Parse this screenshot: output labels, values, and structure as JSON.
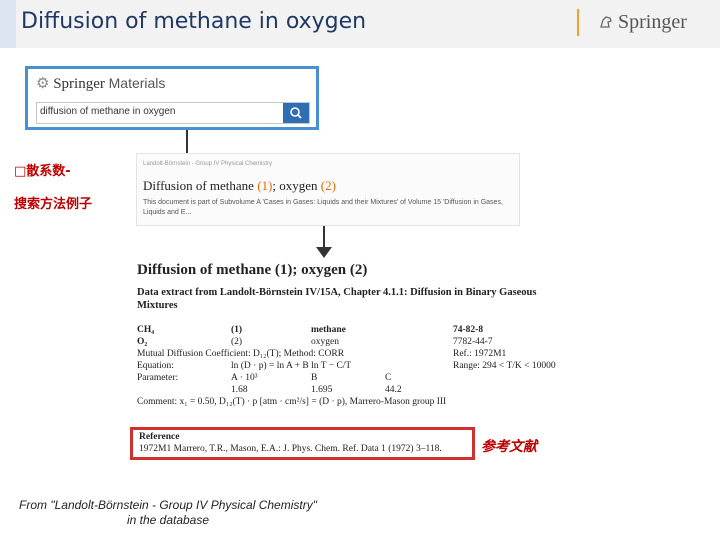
{
  "header": {
    "title": "Diffusion of methane in oxygen",
    "logo": "Springer"
  },
  "springer_materials": {
    "logo_brand": "Springer",
    "logo_suffix": "Materials",
    "search_value": "diffusion of methane in oxygen",
    "search_icon": "search-icon"
  },
  "labels": {
    "left_line1": "□散系数-",
    "left_line2": "搜索方法例子",
    "reference_tag": "参考文献"
  },
  "search_result": {
    "breadcrumb": "Landolt-Börnstein - Group IV Physical Chemistry",
    "title_a": "Diffusion of methane ",
    "title_n1": "(1)",
    "title_b": "; oxygen ",
    "title_n2": "(2)",
    "description": "This document is part of Subvolume A 'Cases in Gases: Liquids and their Mixtures' of Volume 15 'Diffusion in Gases, Liquids and E..."
  },
  "document": {
    "title": "Diffusion of methane (1); oxygen (2)",
    "subtitle": "Data extract from Landolt-Börnstein IV/15A, Chapter 4.1.1: Diffusion in Binary Gaseous Mixtures",
    "rows": {
      "ch4": {
        "formula": "CH₄",
        "num": "(1)",
        "name": "methane",
        "cas": "74-82-8"
      },
      "o2": {
        "formula": "O₂",
        "num": "(2)",
        "name": "oxygen",
        "cas": "7782-44-7"
      },
      "mutual": {
        "label": "Mutual Diffusion Coefficient: D₁₂(T); Method: CORR",
        "ref": "Ref.: 1972M1"
      },
      "equation": {
        "label": "Equation:",
        "expr": "ln (D · p) = ln A + B ln T − C/T",
        "range": "Range: 294 < T/K < 10000"
      },
      "parameter": {
        "label": "Parameter:",
        "a": "A · 10³",
        "b": "B",
        "c": "C"
      },
      "values": {
        "a": "1.68",
        "b": "1.695",
        "c": "44.2"
      },
      "comment": "Comment: x₁ = 0.50, D₁₂(T) · p [atm · cm²/s] = (D · p), Marrero-Mason group III"
    }
  },
  "reference": {
    "heading": "Reference",
    "line": "1972M1     Marrero, T.R., Mason, E.A.: J. Phys. Chem. Ref. Data 1 (1972) 3–118."
  },
  "caption": {
    "line1": "From \"Landolt-Börnstein - Group IV Physical Chemistry\"",
    "line2": "in the database"
  }
}
